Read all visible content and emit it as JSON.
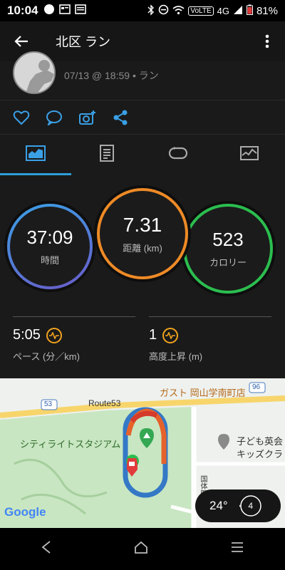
{
  "status_bar": {
    "time": "10:04",
    "network": "4G",
    "volte": "VoLTE",
    "battery": "81%"
  },
  "app_bar": {
    "title": "北区 ラン"
  },
  "activity": {
    "meta": "07/13 @ 18:59 • ラン"
  },
  "stats": {
    "time": {
      "value": "37:09",
      "label": "時間"
    },
    "distance": {
      "value": "7.31",
      "label": "距離 (km)"
    },
    "calories": {
      "value": "523",
      "label": "カロリー"
    },
    "pace": {
      "value": "5:05",
      "label": "ペース (分／km)"
    },
    "elevation": {
      "value": "1",
      "label": "高度上昇 (m)"
    }
  },
  "map": {
    "poi_restaurant": "ガスト 岡山学南町店",
    "road": "Route53",
    "stadium": "シティライトスタジアム",
    "poi_school": "子ども英会",
    "poi_school_2": "キッズクラ",
    "route_no_53": "53",
    "route_no_96": "96",
    "street": "国体町",
    "google": "Google",
    "temperature": "24°",
    "wind": "4"
  },
  "colors": {
    "accent": "#2d9fd9",
    "distance_ring": "#ee8a26",
    "calories_ring": "#2bbe4f",
    "time_ring": "#3aa0e6"
  }
}
